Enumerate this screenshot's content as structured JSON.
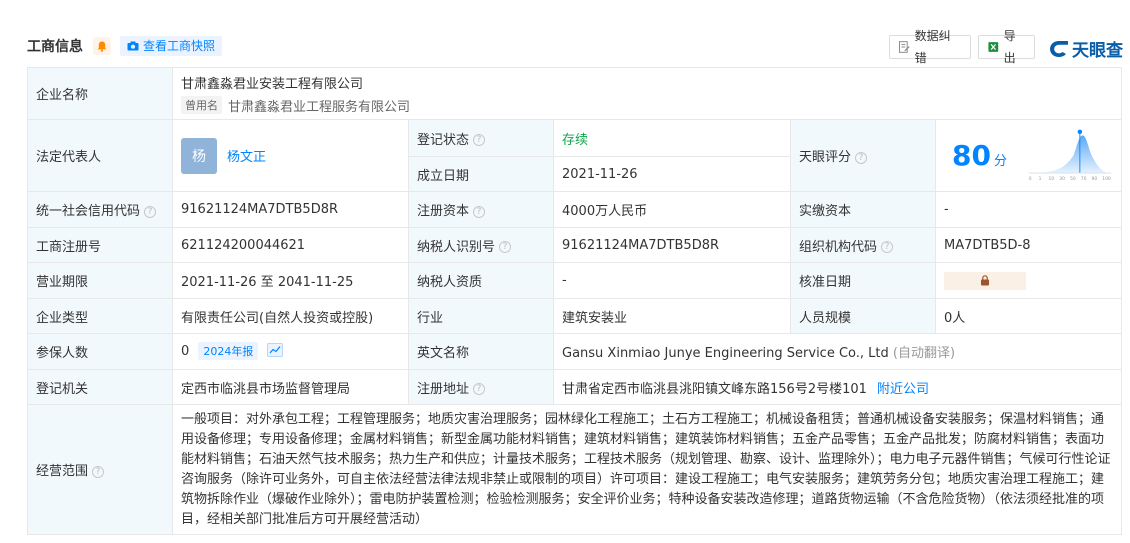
{
  "header": {
    "title": "工商信息",
    "snapshot_label": "查看工商快照",
    "fix_label": "数据纠错",
    "export_label": "导出",
    "brand": "天眼查"
  },
  "colors": {
    "accent": "#0084ff",
    "label_bg": "#f2f9fc",
    "status_green": "#14a34b"
  },
  "info": {
    "company_name_label": "企业名称",
    "company_name": "甘肃鑫淼君业安装工程有限公司",
    "former_tag": "曾用名",
    "former_name": "甘肃鑫淼君业工程服务有限公司",
    "legal_rep_label": "法定代表人",
    "legal_rep_avatar": "杨",
    "legal_rep": "杨文正",
    "reg_status_label": "登记状态",
    "reg_status": "存续",
    "founded_label": "成立日期",
    "founded": "2021-11-26",
    "score_label": "天眼评分",
    "score": "80",
    "score_unit": "分",
    "credit_code_label": "统一社会信用代码",
    "credit_code": "91621124MA7DTB5D8R",
    "reg_capital_label": "注册资本",
    "reg_capital": "4000万人民币",
    "paid_capital_label": "实缴资本",
    "paid_capital": "-",
    "reg_no_label": "工商注册号",
    "reg_no": "621124200044621",
    "taxpayer_id_label": "纳税人识别号",
    "taxpayer_id": "91621124MA7DTB5D8R",
    "org_code_label": "组织机构代码",
    "org_code": "MA7DTB5D-8",
    "term_label": "营业期限",
    "term": "2021-11-26 至 2041-11-25",
    "taxpayer_qual_label": "纳税人资质",
    "taxpayer_qual": "-",
    "approved_date_label": "核准日期",
    "type_label": "企业类型",
    "type": "有限责任公司(自然人投资或控股)",
    "industry_label": "行业",
    "industry": "建筑安装业",
    "staff_size_label": "人员规模",
    "staff_size": "0人",
    "insured_label": "参保人数",
    "insured": "0",
    "insured_year": "2024年报",
    "english_name_label": "英文名称",
    "english_name": "Gansu Xinmiao Junye Engineering Service Co., Ltd",
    "auto_translate": "(自动翻译)",
    "authority_label": "登记机关",
    "authority": "定西市临洮县市场监督管理局",
    "address_label": "注册地址",
    "address": "甘肃省定西市临洮县洮阳镇文峰东路156号2号楼101",
    "nearby_label": "附近公司",
    "scope_label": "经营范围",
    "scope": "一般项目：对外承包工程；工程管理服务；地质灾害治理服务；园林绿化工程施工；土石方工程施工；机械设备租赁；普通机械设备安装服务；保温材料销售；通用设备修理；专用设备修理；金属材料销售；新型金属功能材料销售；建筑材料销售；建筑装饰材料销售；五金产品零售；五金产品批发；防腐材料销售；表面功能材料销售；石油天然气技术服务；热力生产和供应；计量技术服务；工程技术服务（规划管理、勘察、设计、监理除外）；电力电子元器件销售；气候可行性论证咨询服务（除许可业务外，可自主依法经营法律法规非禁止或限制的项目）许可项目：建设工程施工；电气安装服务；建筑劳务分包；地质灾害治理工程施工；建筑物拆除作业（爆破作业除外）；雷电防护装置检测；检验检测服务；安全评价业务；特种设备安装改造修理；道路货物运输（不含危险货物）（依法须经批准的项目，经相关部门批准后方可开展经营活动）"
  },
  "score_chart": {
    "ticks": [
      "0",
      "1",
      "10",
      "30",
      "50",
      "70",
      "90",
      "100"
    ],
    "marker": "80"
  }
}
